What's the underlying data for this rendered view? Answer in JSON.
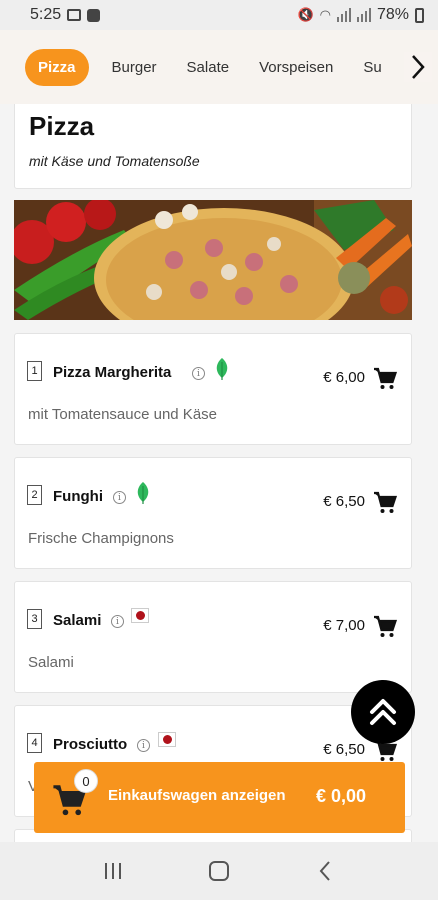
{
  "status_bar": {
    "time": "5:25",
    "battery": "78%"
  },
  "categories": [
    {
      "label": "Pizza",
      "active": true
    },
    {
      "label": "Burger",
      "active": false
    },
    {
      "label": "Salate",
      "active": false
    },
    {
      "label": "Vorspeisen",
      "active": false
    },
    {
      "label": "Su",
      "active": false
    }
  ],
  "section": {
    "title": "Pizza",
    "subtitle": "mit Käse und Tomatensoße"
  },
  "items": [
    {
      "number": "1",
      "name": "Pizza Margherita",
      "badge": "leaf-icon",
      "price": "€ 6,00",
      "description": "mit Tomatensauce und Käse"
    },
    {
      "number": "2",
      "name": "Funghi",
      "badge": "leaf-icon",
      "price": "€ 6,50",
      "description": "Frische Champignons"
    },
    {
      "number": "3",
      "name": "Salami",
      "badge": "flag-icon",
      "price": "€ 7,00",
      "description": "Salami"
    },
    {
      "number": "4",
      "name": "Prosciutto",
      "badge": "flag-icon",
      "price": "€ 6,50",
      "description": "V"
    }
  ],
  "cart": {
    "count": "0",
    "label": "Einkaufswagen anzeigen",
    "total": "€ 0,00"
  },
  "colors": {
    "accent": "#f7941d",
    "leaf": "#2eb85c",
    "flag": "#b0121b"
  }
}
